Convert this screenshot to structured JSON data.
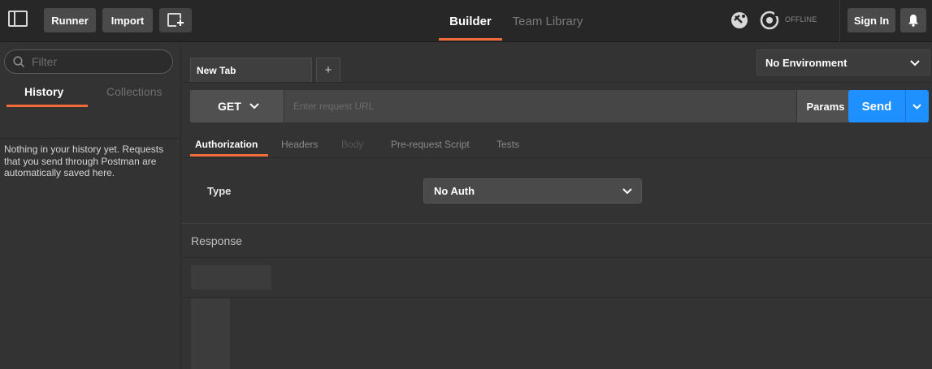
{
  "toolbar": {
    "runner_label": "Runner",
    "import_label": "Import",
    "tabs": [
      {
        "label": "Builder",
        "active": true
      },
      {
        "label": "Team Library",
        "active": false
      }
    ],
    "status_label": "OFFLINE",
    "sign_in_label": "Sign In",
    "icons": [
      "sidebar-toggle-icon",
      "new-window-icon",
      "satellite-icon",
      "sync-icon",
      "bell-icon"
    ]
  },
  "sidebar": {
    "filter_placeholder": "Filter",
    "tabs": [
      {
        "label": "History",
        "active": true
      },
      {
        "label": "Collections",
        "active": false
      }
    ],
    "empty_message": "Nothing in your history yet. Requests that you send through Postman are automatically saved here."
  },
  "main": {
    "tabs": [
      {
        "label": "New Tab"
      }
    ],
    "add_tab_label": "+",
    "environment": "No Environment",
    "method": "GET",
    "url_placeholder": "Enter request URL",
    "url_value": "",
    "params_label": "Params",
    "send_label": "Send",
    "subtabs": [
      {
        "label": "Authorization",
        "state": "active"
      },
      {
        "label": "Headers",
        "state": "inactive"
      },
      {
        "label": "Body",
        "state": "disabled"
      },
      {
        "label": "Pre-request Script",
        "state": "inactive"
      },
      {
        "label": "Tests",
        "state": "inactive"
      }
    ],
    "auth": {
      "type_label": "Type",
      "selected": "No Auth"
    },
    "response_label": "Response"
  },
  "colors": {
    "accent": "#f26b3a",
    "send": "#1e90ff",
    "background": "#333333",
    "topbar": "#272727"
  }
}
